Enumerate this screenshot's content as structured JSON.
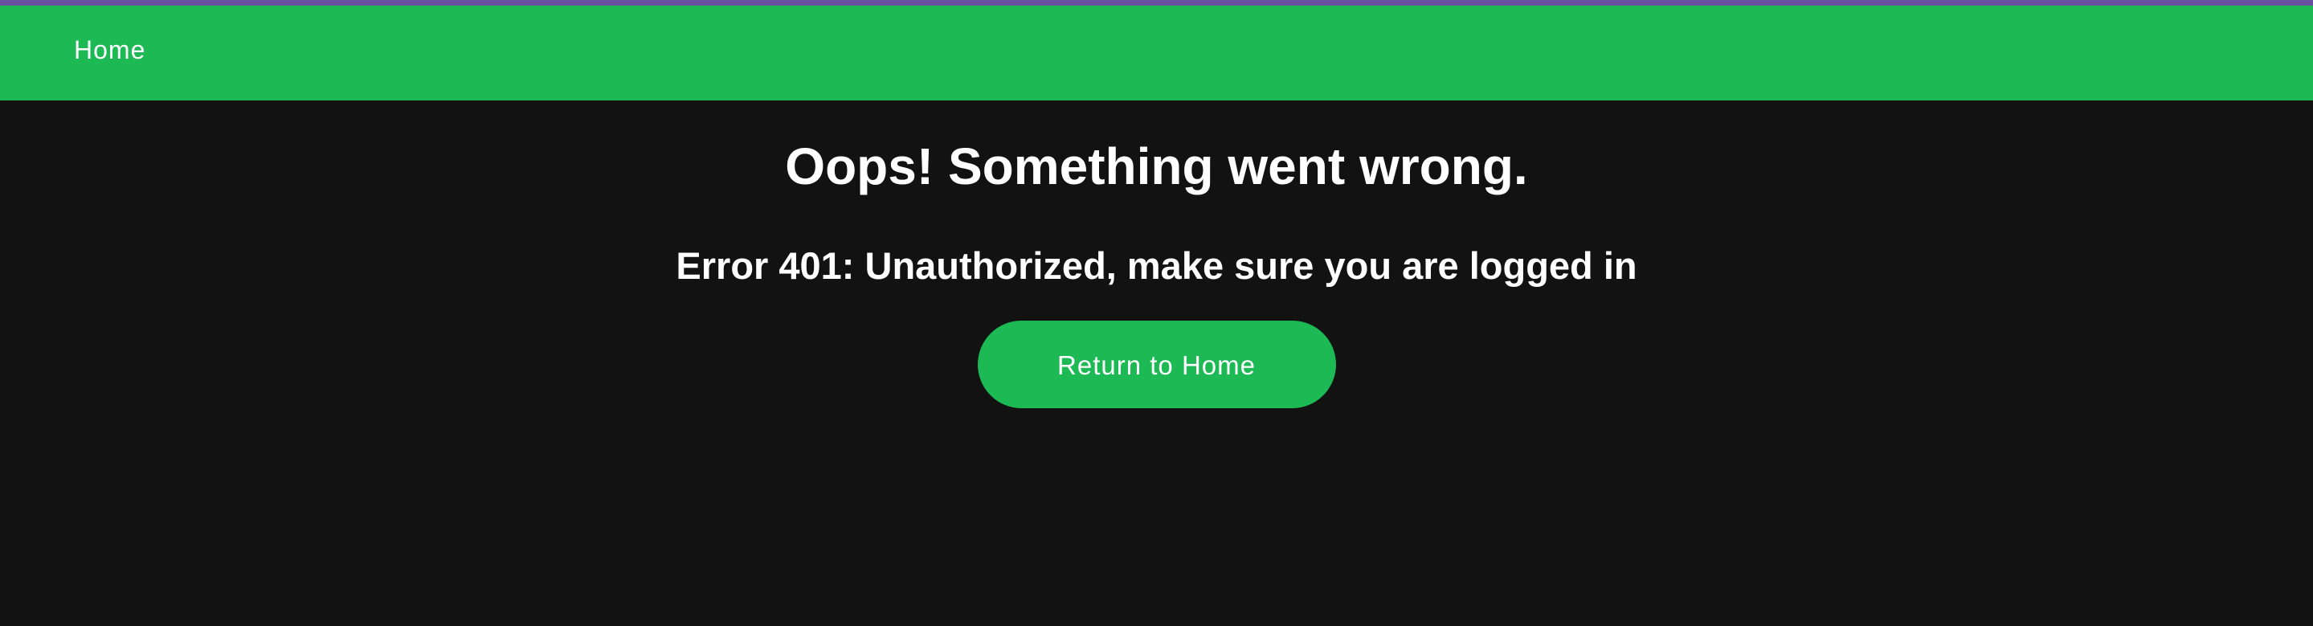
{
  "nav": {
    "home_label": "Home"
  },
  "error_page": {
    "title": "Oops! Something went wrong.",
    "message": "Error 401: Unauthorized, make sure you are logged in",
    "return_button_label": "Return to Home"
  },
  "colors": {
    "accent": "#1db954",
    "background": "#121212",
    "top_strip": "#6b4fa0",
    "text": "#ffffff"
  }
}
